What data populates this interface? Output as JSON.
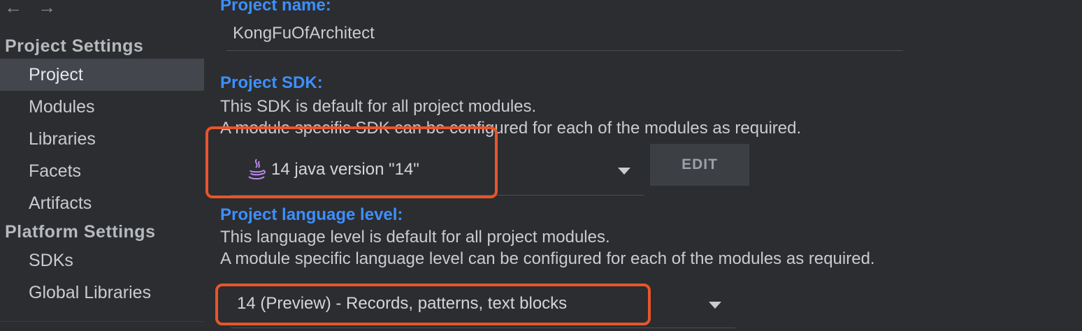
{
  "nav": {
    "back_glyph": "←",
    "forward_glyph": "→"
  },
  "sidebar": {
    "project_settings_title": "Project Settings",
    "project_items": [
      "Project",
      "Modules",
      "Libraries",
      "Facets",
      "Artifacts"
    ],
    "platform_settings_title": "Platform Settings",
    "platform_items": [
      "SDKs",
      "Global Libraries"
    ],
    "selected": "Project"
  },
  "main": {
    "project_name_label": "Project name:",
    "project_name_value": "KongFuOfArchitect",
    "sdk_label": "Project SDK:",
    "sdk_desc_1": "This SDK is default for all project modules.",
    "sdk_desc_2": "A module specific SDK can be configured for each of the modules as required.",
    "sdk_value": "14 java version \"14\"",
    "sdk_icon": "java-icon",
    "edit_label": "EDIT",
    "lang_label": "Project language level:",
    "lang_desc_1": "This language level is default for all project modules.",
    "lang_desc_2": "A module specific language level can be configured for each of the modules as required.",
    "lang_value": "14 (Preview) - Records, patterns, text blocks"
  },
  "colors": {
    "background": "#2b2d30",
    "accent_blue": "#3d8fff",
    "selection": "#43464c",
    "highlight_border": "#e8552b"
  }
}
